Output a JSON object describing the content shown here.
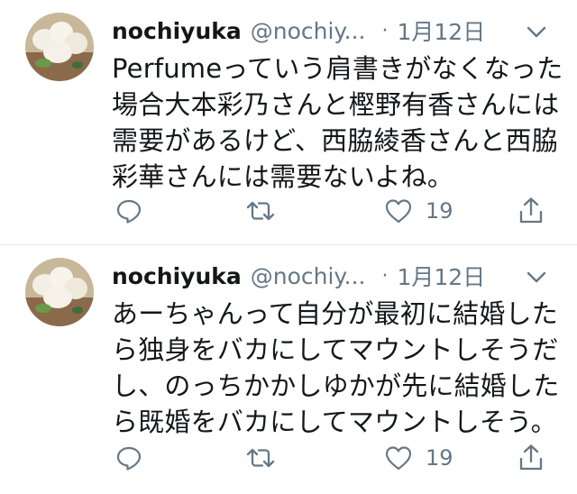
{
  "colors": {
    "text": "#14171a",
    "secondary": "#657786",
    "divider": "#e6ecf0"
  },
  "tweets": [
    {
      "user": {
        "name": "nochiyuka",
        "handle": "@nochiy...",
        "avatar_icon": "avatar-image"
      },
      "separator": "·",
      "date": "1月12日",
      "body_lines": [
        "Perfumeっていう肩書きがなくなった",
        "場合大本彩乃さんと樫野有香さんには",
        "需要があるけど、西脇綾香さんと西脇",
        "彩華さんには需要ないよね。"
      ],
      "actions": {
        "reply_icon": "reply-icon",
        "retweet_icon": "retweet-icon",
        "like_icon": "heart-icon",
        "like_count": "19",
        "share_icon": "share-icon"
      }
    },
    {
      "user": {
        "name": "nochiyuka",
        "handle": "@nochiy...",
        "avatar_icon": "avatar-image"
      },
      "separator": "·",
      "date": "1月12日",
      "body_lines": [
        "あーちゃんって自分が最初に結婚した",
        "ら独身をバカにしてマウントしそうだ",
        "し、のっちかかしゆかが先に結婚した",
        "ら既婚をバカにしてマウントしそう。"
      ],
      "actions": {
        "reply_icon": "reply-icon",
        "retweet_icon": "retweet-icon",
        "like_icon": "heart-icon",
        "like_count": "19",
        "share_icon": "share-icon"
      }
    }
  ]
}
